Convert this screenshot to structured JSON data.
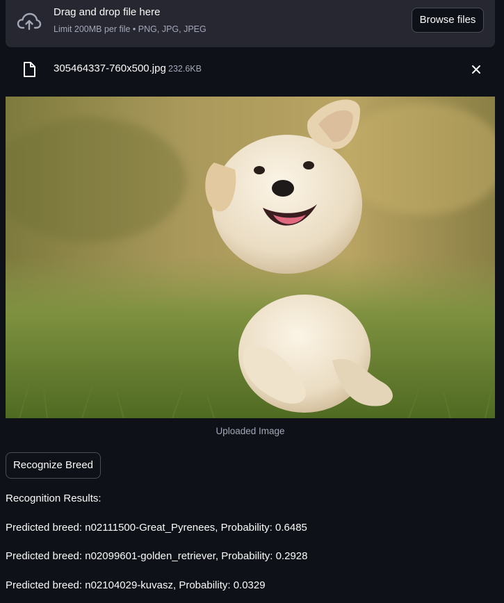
{
  "uploader": {
    "title": "Drag and drop file here",
    "subtitle": "Limit 200MB per file • PNG, JPG, JPEG",
    "browse_label": "Browse files",
    "icon": "cloud-upload-icon"
  },
  "file": {
    "name": "305464337-760x500.jpg",
    "size": "232.6KB",
    "icon": "file-icon",
    "remove_icon": "close-icon"
  },
  "image": {
    "caption": "Uploaded Image"
  },
  "action": {
    "recognize_label": "Recognize Breed"
  },
  "results": {
    "heading": "Recognition Results:",
    "predictions": [
      "Predicted breed: n02111500-Great_Pyrenees, Probability: 0.6485",
      "Predicted breed: n02099601-golden_retriever, Probability: 0.2928",
      "Predicted breed: n02104029-kuvasz, Probability: 0.0329"
    ]
  },
  "colors": {
    "background": "#0e1117",
    "panel": "#262730",
    "border": "#4b4d57",
    "muted_text": "#a3a8b8"
  }
}
